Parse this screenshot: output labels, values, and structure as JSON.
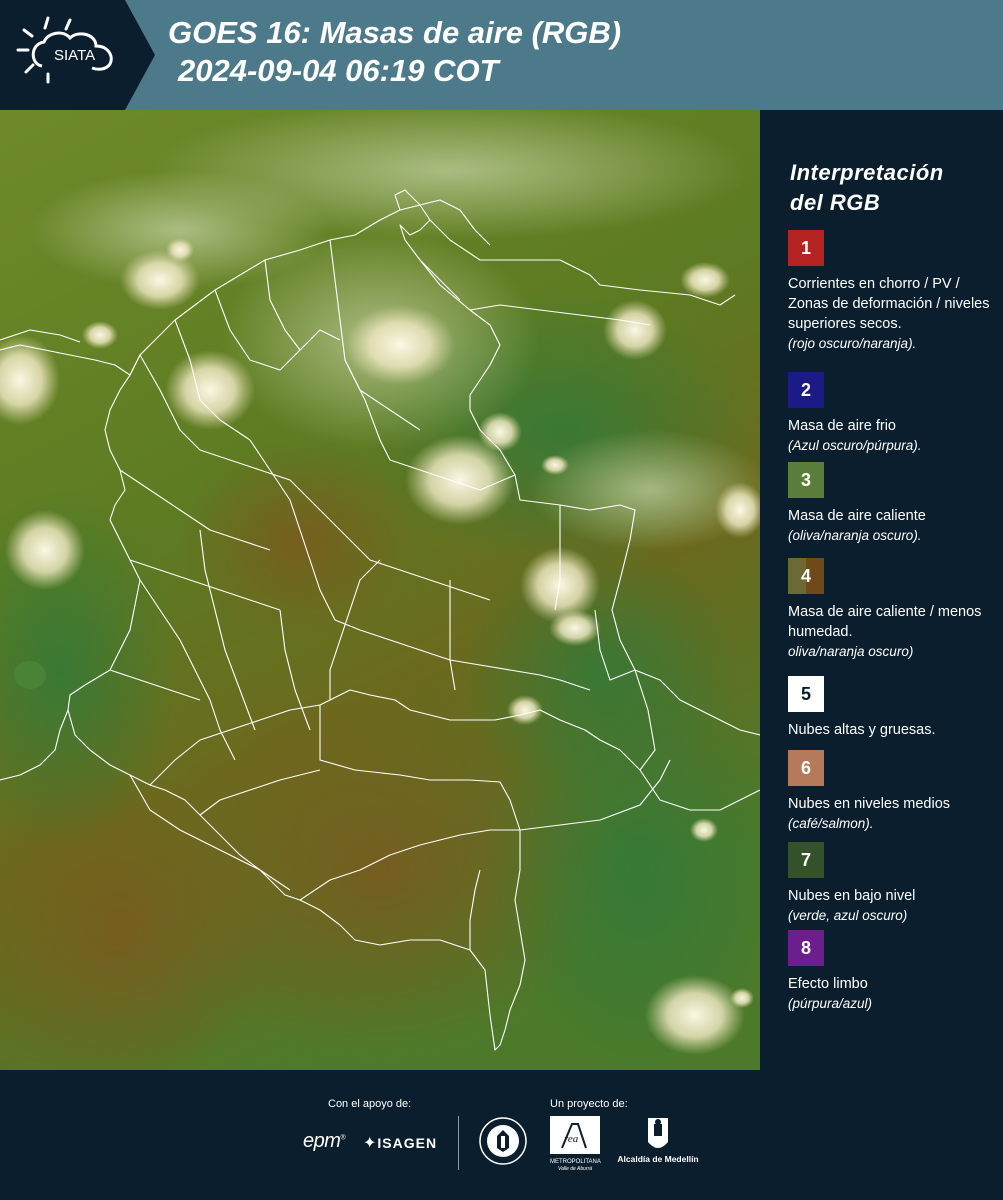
{
  "header": {
    "logo_text": "SIATA",
    "title_line1": "GOES 16: Masas de aire (RGB)",
    "title_line2": "2024-09-04 06:19 COT",
    "background_color": "#4d7a8b",
    "logo_background_color": "#0b1e2d"
  },
  "legend": {
    "title_line1": "Interpretación",
    "title_line2": "del RGB",
    "items": [
      {
        "number": "1",
        "color": "#b52222",
        "text": "Corrientes en chorro / PV / Zonas de deformación / niveles superiores secos.",
        "sub": "(rojo oscuro/naranja)."
      },
      {
        "number": "2",
        "color": "#1b1a86",
        "text": "Masa de aire frio",
        "sub": "(Azul oscuro/púrpura)."
      },
      {
        "number": "3",
        "color": "#5b7f3a",
        "text": "Masa de aire caliente",
        "sub": "(oliva/naranja oscuro)."
      },
      {
        "number": "4",
        "color": "#6a6a32",
        "color2": "#6e4a1a",
        "text": "Masa de aire caliente / menos humedad.",
        "sub": "oliva/naranja oscuro)"
      },
      {
        "number": "5",
        "color": "#ffffff",
        "text": "Nubes altas y gruesas.",
        "sub": ""
      },
      {
        "number": "6",
        "color": "#b57a5a",
        "text": "Nubes en niveles medios",
        "sub": "(café/salmon)."
      },
      {
        "number": "7",
        "color": "#34522a",
        "text": "Nubes en bajo nivel",
        "sub": "(verde, azul oscuro)"
      },
      {
        "number": "8",
        "color": "#6c1e8c",
        "text": "Efecto limbo",
        "sub": "(púrpura/azul)"
      }
    ]
  },
  "footer": {
    "support_label": "Con el apoyo de:",
    "project_label": "Un proyecto de:",
    "sponsor_epm": "epm",
    "sponsor_isagen": "ISAGEN",
    "logo_metropolitana": "METROPOLITANA",
    "logo_valle": "Valle de Aburrá",
    "logo_alcaldia": "Alcaldía de Medellín"
  },
  "map": {
    "region_labels": [],
    "land_color": "#5a7a20",
    "cloud_color": "#f4f0d4",
    "border_color": "#ffffff"
  }
}
